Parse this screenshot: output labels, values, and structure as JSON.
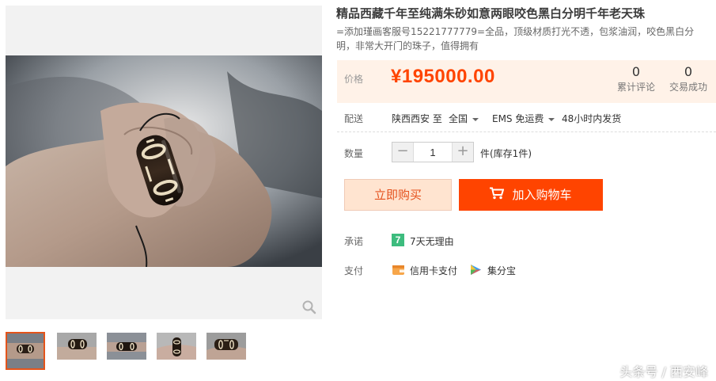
{
  "product": {
    "title": "精品西藏千年至纯满朱砂如意两眼咬色黑白分明千年老天珠",
    "subtitle": "=添加瑾画客服号15221777779=全品，顶级材质打光不透，包浆油润，咬色黑白分明，非常大开门的珠子，值得拥有"
  },
  "price": {
    "label": "价格",
    "value": "¥195000.00",
    "reviews_count": "0",
    "reviews_label": "累计评论",
    "deals_count": "0",
    "deals_label": "交易成功"
  },
  "delivery": {
    "label": "配送",
    "from": "陕西西安 至",
    "to": "全国",
    "shipping": "EMS 免运费",
    "dispatch": "48小时内发货"
  },
  "quantity": {
    "label": "数量",
    "minus": "−",
    "value": "1",
    "plus": "+",
    "stock": "件(库存1件)"
  },
  "actions": {
    "buy_now": "立即购买",
    "add_to_cart": "加入购物车"
  },
  "promise": {
    "label": "承诺",
    "badge": "7",
    "text": "7天无理由"
  },
  "payment": {
    "label": "支付",
    "credit_card": "信用卡支付",
    "points": "集分宝"
  },
  "watermark": "头条号 / 西安峰",
  "colors": {
    "accent": "#ff4400",
    "price": "#ff4400",
    "price_bg": "#fff2e8",
    "buy_bg": "#ffe4d0",
    "thumb_active_border": "#e4541b",
    "promise_green": "#3dbc7e"
  },
  "icons": [
    "search-zoom-icon",
    "cart-icon",
    "caret-down-icon",
    "wallet-icon",
    "jifenbao-icon"
  ]
}
